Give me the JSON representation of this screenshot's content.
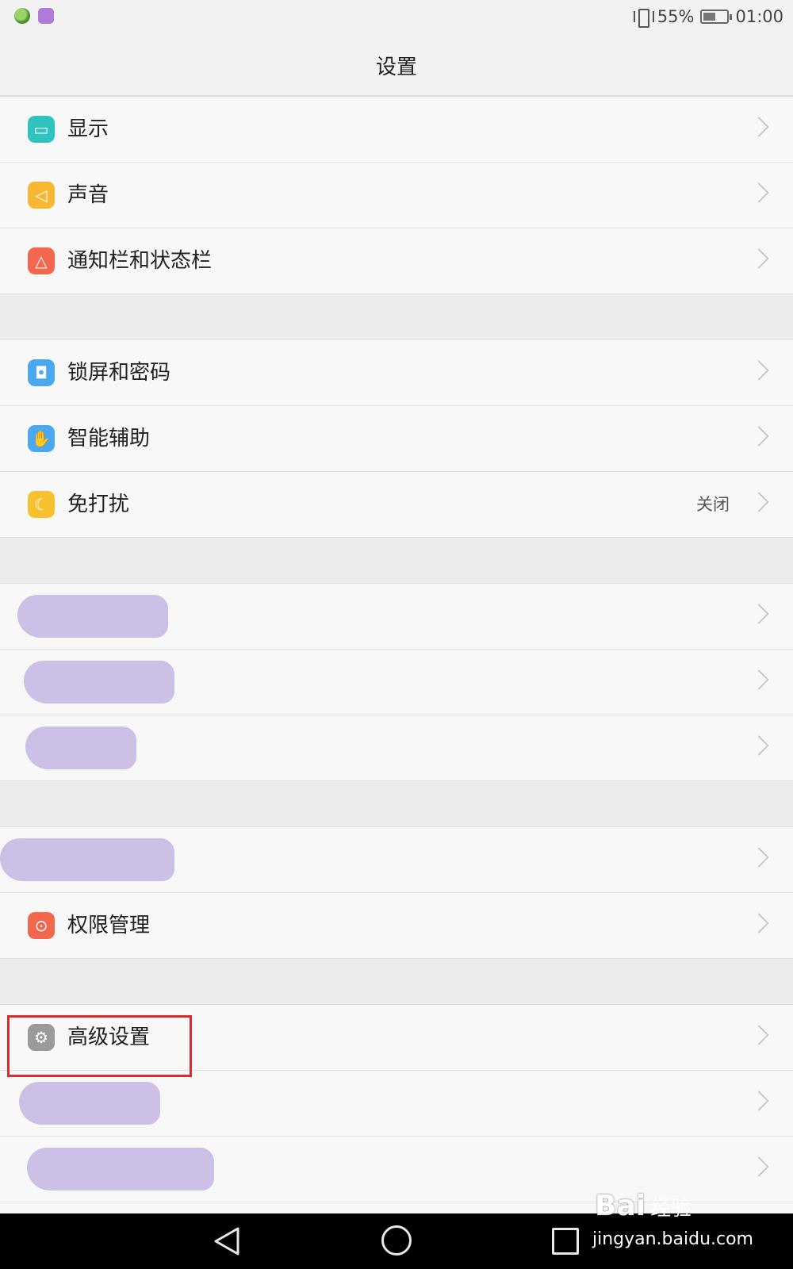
{
  "status_bar": {
    "battery_percent": "55%",
    "battery_level": 0.55,
    "time": "01:00",
    "icons": [
      "app-notification-icon",
      "gallery-notification-icon",
      "vibrate-icon",
      "battery-icon"
    ]
  },
  "header": {
    "title": "设置"
  },
  "rows": {
    "display": {
      "label": "显示",
      "icon": "display-icon",
      "color": "#2fc3c0"
    },
    "sound": {
      "label": "声音",
      "icon": "speaker-icon",
      "color": "#f7b733"
    },
    "notification": {
      "label": "通知栏和状态栏",
      "icon": "bell-icon",
      "color": "#f2674d"
    },
    "lockscreen": {
      "label": "锁屏和密码",
      "icon": "lock-icon",
      "color": "#4aa8f0"
    },
    "smart_assist": {
      "label": "智能辅助",
      "icon": "hand-icon",
      "color": "#4aa8f0"
    },
    "dnd": {
      "label": "免打扰",
      "value": "关闭",
      "icon": "moon-icon",
      "color": "#f7c02f"
    },
    "permissions": {
      "label": "权限管理",
      "icon": "permission-icon",
      "color": "#f2674d"
    },
    "advanced": {
      "label": "高级设置",
      "icon": "gear-icon",
      "color": "#9a9a9a"
    }
  },
  "nav_bar": {
    "icons": [
      "back-icon",
      "home-icon",
      "recents-icon"
    ]
  },
  "watermark": {
    "logo": "Bai",
    "logo_cn": "经验",
    "url": "jingyan.baidu.com"
  },
  "colors": {
    "highlight_border": "#e02a2a",
    "redaction": "#c9bde6"
  }
}
